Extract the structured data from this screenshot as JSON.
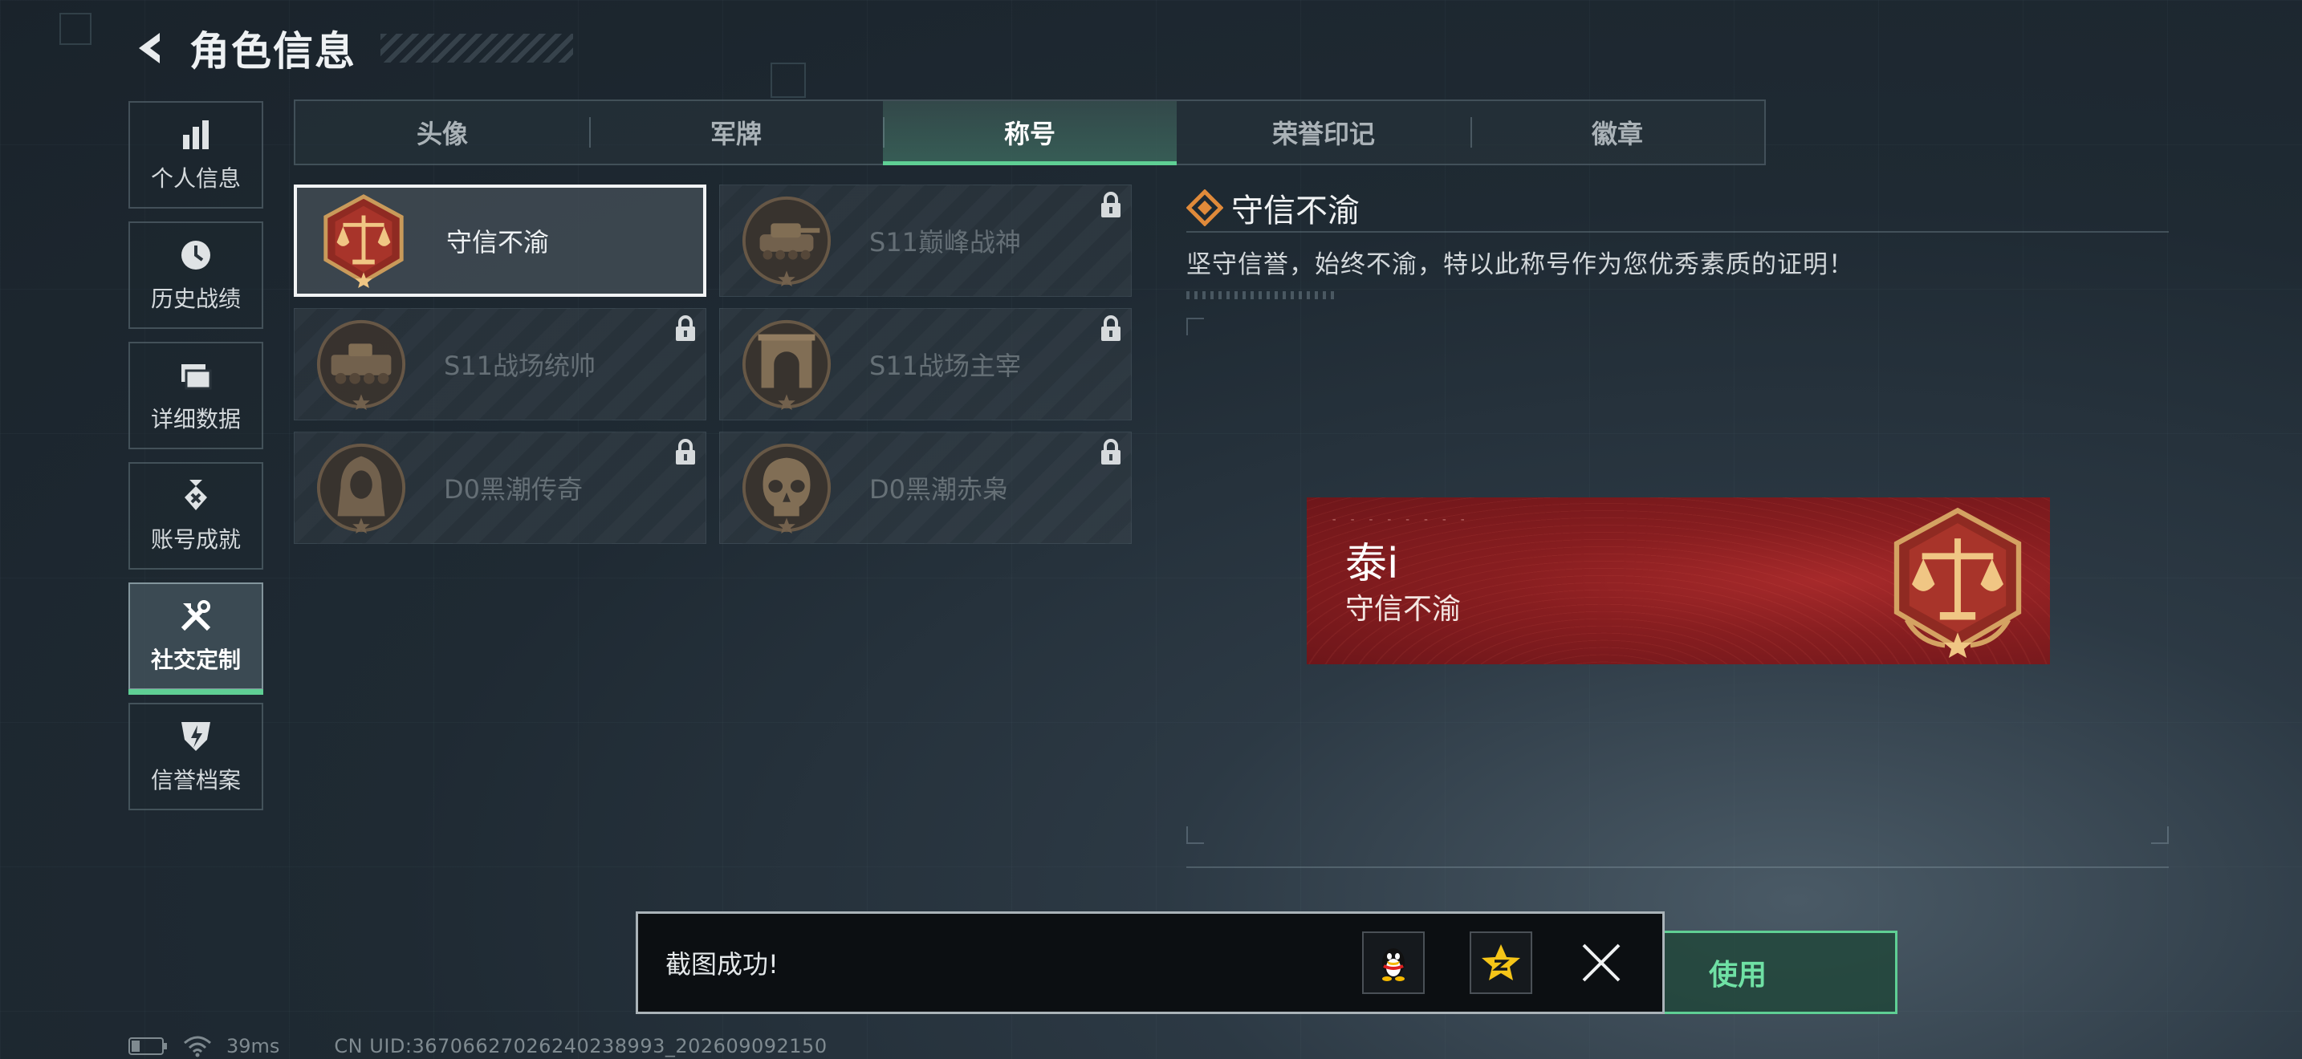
{
  "header": {
    "title": "角色信息"
  },
  "sidebar": {
    "items": [
      {
        "label": "个人信息",
        "icon": "bar-chart-icon"
      },
      {
        "label": "历史战绩",
        "icon": "clock-icon"
      },
      {
        "label": "详细数据",
        "icon": "folder-icon"
      },
      {
        "label": "账号成就",
        "icon": "achievement-icon"
      },
      {
        "label": "社交定制",
        "icon": "tools-icon",
        "active": true
      },
      {
        "label": "信誉档案",
        "icon": "shield-icon"
      }
    ]
  },
  "tabs": [
    {
      "label": "头像"
    },
    {
      "label": "军牌"
    },
    {
      "label": "称号",
      "active": true
    },
    {
      "label": "荣誉印记"
    },
    {
      "label": "徽章"
    }
  ],
  "titles": [
    {
      "label": "守信不渝",
      "medal": "scales-medal-icon",
      "selected": true,
      "locked": false
    },
    {
      "label": "S11巅峰战神",
      "medal": "tank-medal-icon",
      "selected": false,
      "locked": true
    },
    {
      "label": "S11战场统帅",
      "medal": "apc-medal-icon",
      "selected": false,
      "locked": true
    },
    {
      "label": "S11战场主宰",
      "medal": "arch-medal-icon",
      "selected": false,
      "locked": true
    },
    {
      "label": "D0黑潮传奇",
      "medal": "hooded-figure-medal-icon",
      "selected": false,
      "locked": true
    },
    {
      "label": "D0黑潮赤枭",
      "medal": "skull-medal-icon",
      "selected": false,
      "locked": true
    }
  ],
  "detail": {
    "title": "守信不渝",
    "description": "坚守信誉，始终不渝，特以此称号作为您优秀素质的证明！"
  },
  "nameplate": {
    "player_name": "泰i",
    "title": "守信不渝"
  },
  "use_button": {
    "label": "使用"
  },
  "toast": {
    "message": "截图成功!"
  },
  "statusbar": {
    "ping": "39ms",
    "uid": "CN UID:36706627026240238993_202609092150"
  },
  "colors": {
    "accent": "#5fcf94",
    "nameplate_red": "#9e2226",
    "medal_bronze": "#b8864a"
  }
}
